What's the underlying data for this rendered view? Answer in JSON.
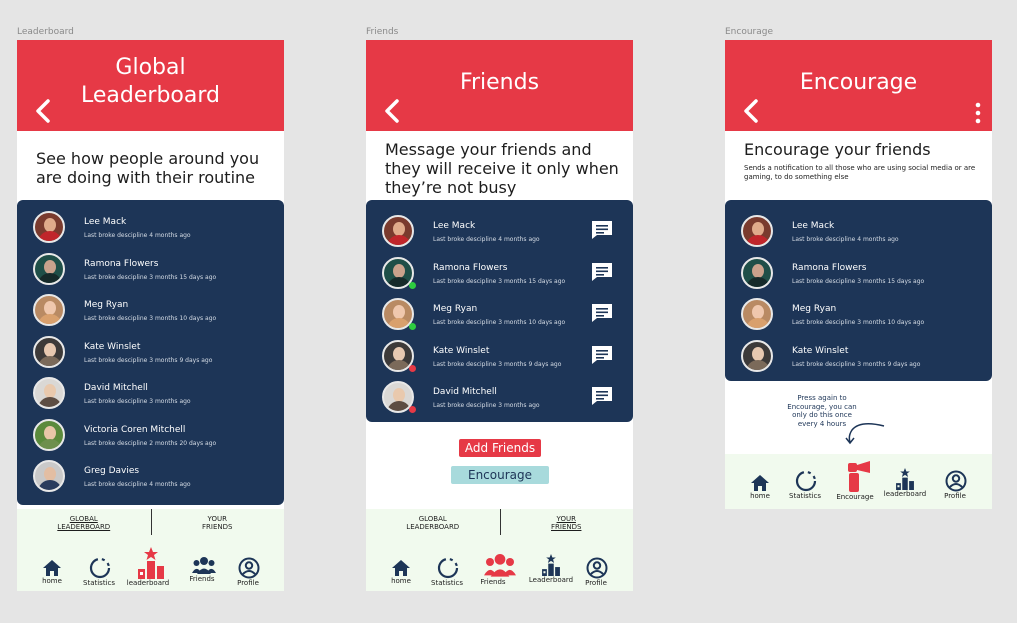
{
  "colors": {
    "red": "#e63946",
    "navy": "#1d3557",
    "mint": "#f1faee",
    "teal": "#a8dadc"
  },
  "frames": {
    "leaderboard": "Leaderboard",
    "friends": "Friends",
    "encourage": "Encourage"
  },
  "leaderboard": {
    "title": "Global\nLeaderboard",
    "intro": "See how people around you are doing with their routine",
    "people": [
      {
        "name": "Lee Mack",
        "sub": "Last broke descipline 4 months ago"
      },
      {
        "name": "Ramona Flowers",
        "sub": "Last broke descipline 3 months 15 days ago"
      },
      {
        "name": "Meg Ryan",
        "sub": "Last broke descipline 3 months 10 days ago"
      },
      {
        "name": "Kate Winslet",
        "sub": "Last broke descipline 3 months 9 days ago"
      },
      {
        "name": "David Mitchell",
        "sub": "Last broke descipline 3 months ago"
      },
      {
        "name": "Victoria Coren Mitchell",
        "sub": "Last broke descipline 2 months 20 days  ago"
      },
      {
        "name": "Greg Davies",
        "sub": "Last broke descipline 4 months ago"
      }
    ],
    "tabs": {
      "global": "GLOBAL\nLEADERBOARD",
      "friends": "YOUR\nFRIENDS"
    },
    "nav": {
      "home": "home",
      "statistics": "Statistics",
      "leaderboard": "leaderboard",
      "friends": "Friends",
      "profile": "Profile"
    }
  },
  "friends": {
    "title": "Friends",
    "intro": "Message your friends and they will receive it only when they’re not busy",
    "people": [
      {
        "name": "Lee Mack",
        "sub": "Last broke descipline 4 months ago"
      },
      {
        "name": "Ramona Flowers",
        "sub": "Last broke descipline 3 months 15 days ago"
      },
      {
        "name": "Meg Ryan",
        "sub": "Last broke descipline 3 months 10 days ago"
      },
      {
        "name": "Kate Winslet",
        "sub": "Last broke descipline 3 months 9 days ago"
      },
      {
        "name": "David Mitchell",
        "sub": "Last broke descipline 3 months ago"
      }
    ],
    "add_button": "Add Friends",
    "encourage_button": "Encourage",
    "tabs": {
      "global": "GLOBAL\nLEADERBOARD",
      "friends": "YOUR\nFRIENDS"
    },
    "nav": {
      "home": "home",
      "statistics": "Statistics",
      "friends": "Friends",
      "leaderboard": "Leaderboard",
      "profile": "Profile"
    }
  },
  "encourage": {
    "title": "Encourage",
    "intro": "Encourage your friends",
    "intro_small": "Sends a notification to all those who are using social media or are gaming, to do something else",
    "people": [
      {
        "name": "Lee Mack",
        "sub": "Last broke descipline 4 months ago"
      },
      {
        "name": "Ramona Flowers",
        "sub": "Last broke descipline 3 months 15 days ago"
      },
      {
        "name": "Meg Ryan",
        "sub": "Last broke descipline 3 months 10 days ago"
      },
      {
        "name": "Kate Winslet",
        "sub": "Last broke descipline 3 months 9 days ago"
      }
    ],
    "note": "Press again to\nEncourage, you can\nonly do this once\nevery 4 hours",
    "nav": {
      "home": "home",
      "statistics": "Statistics",
      "encourage": "Encourage",
      "leaderboard": "leaderboard",
      "profile": "Profile"
    }
  }
}
